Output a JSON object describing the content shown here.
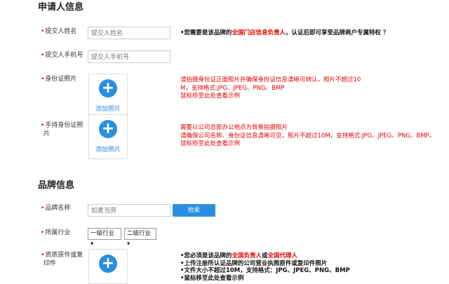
{
  "applicant": {
    "title": "申请人信息",
    "name_label": "提交人姓名",
    "name_placeholder": "提交人姓名",
    "phone_label": "提交人手机号",
    "phone_placeholder": "提交人手机号",
    "id_label": "身份证照片",
    "handheld_label_1": "手持身份证照",
    "handheld_label_2": "片",
    "add_photo": "添加照片",
    "notice_pre": "•您需要是该品牌的",
    "notice_red": "全国门店信息负责人",
    "notice_post": "，认证后即可享受品牌商户专属特权 ？",
    "id_note_1": "请拍摄身份证正面照片并确保身份证信息清晰可辨认，照片不超过10",
    "id_note_2": "M，支持格式:JPG、JPEG、PNG、BMP",
    "id_note_3": "鼠标移至此处查看示例",
    "hand_note_1": "需要以公司总部办公地点为背景拍摄照片",
    "hand_note_2": "请确保公司名称、身份证信息清晰可见，照片不超过10M，支持格式:JPG、JPEG、PNG、BMP。",
    "hand_note_3": "鼠标移至此处查看示例"
  },
  "brand": {
    "title": "品牌信息",
    "name_label": "品牌名称",
    "name_placeholder": "如麦当劳",
    "search_button": "检索",
    "industry_label": "所属行业",
    "industry_level1": "一级行业",
    "industry_level2": "二级行业",
    "qual_label_1": "资质原件或复",
    "qual_label_2": "印件",
    "qual_note_1_pre": "•您必须是该品牌的",
    "qual_note_1_red1": "全国负责人",
    "qual_note_1_mid": "或",
    "qual_note_1_red2": "全国代理人",
    "qual_note_2": "•上传注册所认证品牌的公司营业执照原件或复印件照片",
    "qual_note_3": "•文件大小不超过10M，支持格式：JPG、JPEG、PNG、BMP",
    "qual_note_4": "•鼠标移至此处查看示例"
  },
  "icons": {
    "plus": "plus-circle-icon",
    "dropdown": "dropdown-arrow-icon"
  },
  "colors": {
    "accent": "#2b8fe0",
    "required": "#e60000"
  }
}
